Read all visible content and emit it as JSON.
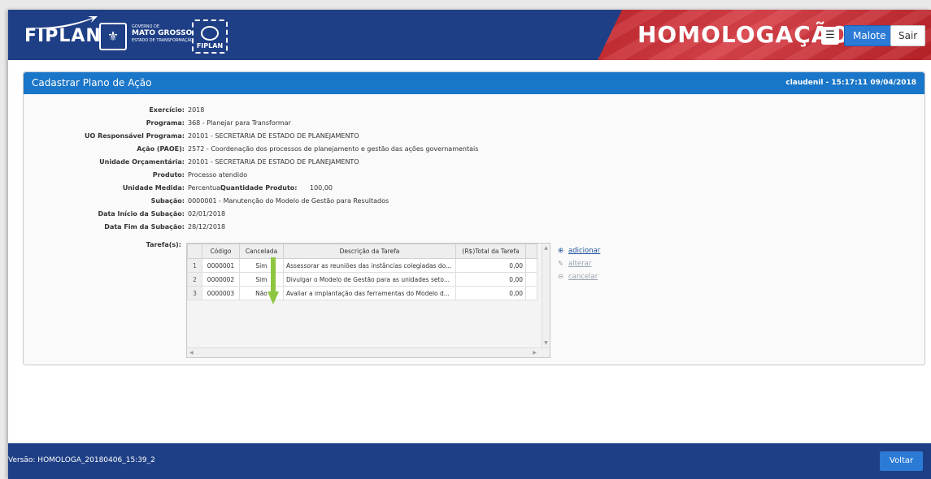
{
  "header": {
    "brand": "FIPLAN",
    "gov_line1": "GOVERNO DE",
    "gov_line2": "MATO GROSSO",
    "gov_line3": "ESTADO DE TRANSFORMAÇÃO",
    "badge": "FIPLAN",
    "environment": "HOMOLOGAÇÃO",
    "menu_icon": "menu-icon",
    "malote_label": "Malote",
    "sair_label": "Sair"
  },
  "panel": {
    "title": "Cadastrar Plano de Ação",
    "user": "claudenil - 15:17:11 09/04/2018"
  },
  "fields": {
    "exercicio": {
      "label": "Exercício:",
      "value": "2018"
    },
    "programa": {
      "label": "Programa:",
      "value": "368 -  Planejar para Transformar"
    },
    "uo_resp": {
      "label": "UO Responsável Programa:",
      "value": "20101 -  SECRETARIA DE ESTADO DE PLANEJAMENTO"
    },
    "acao": {
      "label": "Ação (PAOE):",
      "value": "2572 -  Coordenação dos processos de planejamento e gestão das ações governamentais"
    },
    "unidade_orc": {
      "label": "Unidade Orçamentária:",
      "value": "20101 -  SECRETARIA DE ESTADO DE PLANEJAMENTO"
    },
    "produto": {
      "label": "Produto:",
      "value": "Processo atendido"
    },
    "unidade_medida": {
      "label": "Unidade Medida:",
      "value": "Percentual"
    },
    "quantidade_produto": {
      "label": "Quantidade Produto:",
      "value": "100,00"
    },
    "subacao": {
      "label": "Subação:",
      "value": "0000001 -  Manutenção do Modelo de Gestão para Resultados"
    },
    "data_inicio": {
      "label": "Data Início da Subação:",
      "value": "02/01/2018"
    },
    "data_fim": {
      "label": "Data Fim da Subação:",
      "value": "28/12/2018"
    },
    "tarefas": {
      "label": "Tarefa(s):"
    }
  },
  "grid": {
    "columns": [
      "Código",
      "Cancelada",
      "Descrição da Tarefa",
      "(R$)Total da Tarefa"
    ],
    "rows": [
      {
        "n": "1",
        "codigo": "0000001",
        "cancelada": "Sim",
        "descricao": "Assessorar as reuniões das instâncias colegiadas do...",
        "total": "0,00"
      },
      {
        "n": "2",
        "codigo": "0000002",
        "cancelada": "Sim",
        "descricao": "Divulgar o Modelo de Gestão para as unidades seto...",
        "total": "0,00"
      },
      {
        "n": "3",
        "codigo": "0000003",
        "cancelada": "Não",
        "descricao": "Avaliar a implantação das ferramentas do Modelo d...",
        "total": "0,00"
      }
    ]
  },
  "actions": {
    "adicionar": "adicionar",
    "alterar": "alterar",
    "cancelar": "cancelar"
  },
  "footer": {
    "version": "Versão: HOMOLOGA_20180406_15:39_2",
    "voltar_label": "Voltar"
  },
  "colors": {
    "header_blue": "#1e3f86",
    "panel_blue": "#1a76c8",
    "accent_red": "#c1272d",
    "arrow_green": "#8dc63f"
  }
}
